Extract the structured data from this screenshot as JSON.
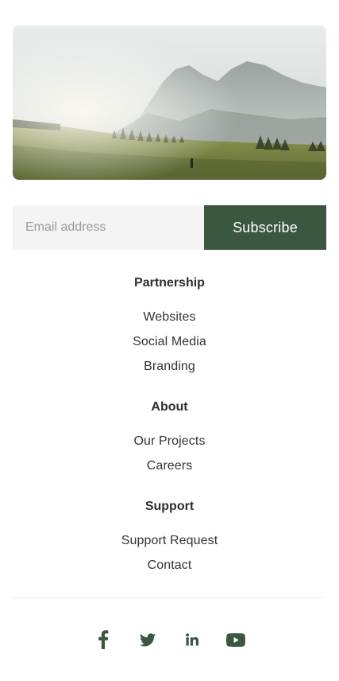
{
  "newsletter": {
    "email_placeholder": "Email address",
    "subscribe_label": "Subscribe"
  },
  "footer_nav": [
    {
      "heading": "Partnership",
      "links": [
        "Websites",
        "Social Media",
        "Branding"
      ]
    },
    {
      "heading": "About",
      "links": [
        "Our Projects",
        "Careers"
      ]
    },
    {
      "heading": "Support",
      "links": [
        "Support Request",
        "Contact"
      ]
    }
  ],
  "social_icons": [
    "facebook-icon",
    "twitter-icon",
    "linkedin-icon",
    "youtube-icon"
  ],
  "colors": {
    "brand_green": "#3b5740",
    "input_background": "#f4f4f4",
    "text": "#2e2e2e"
  }
}
